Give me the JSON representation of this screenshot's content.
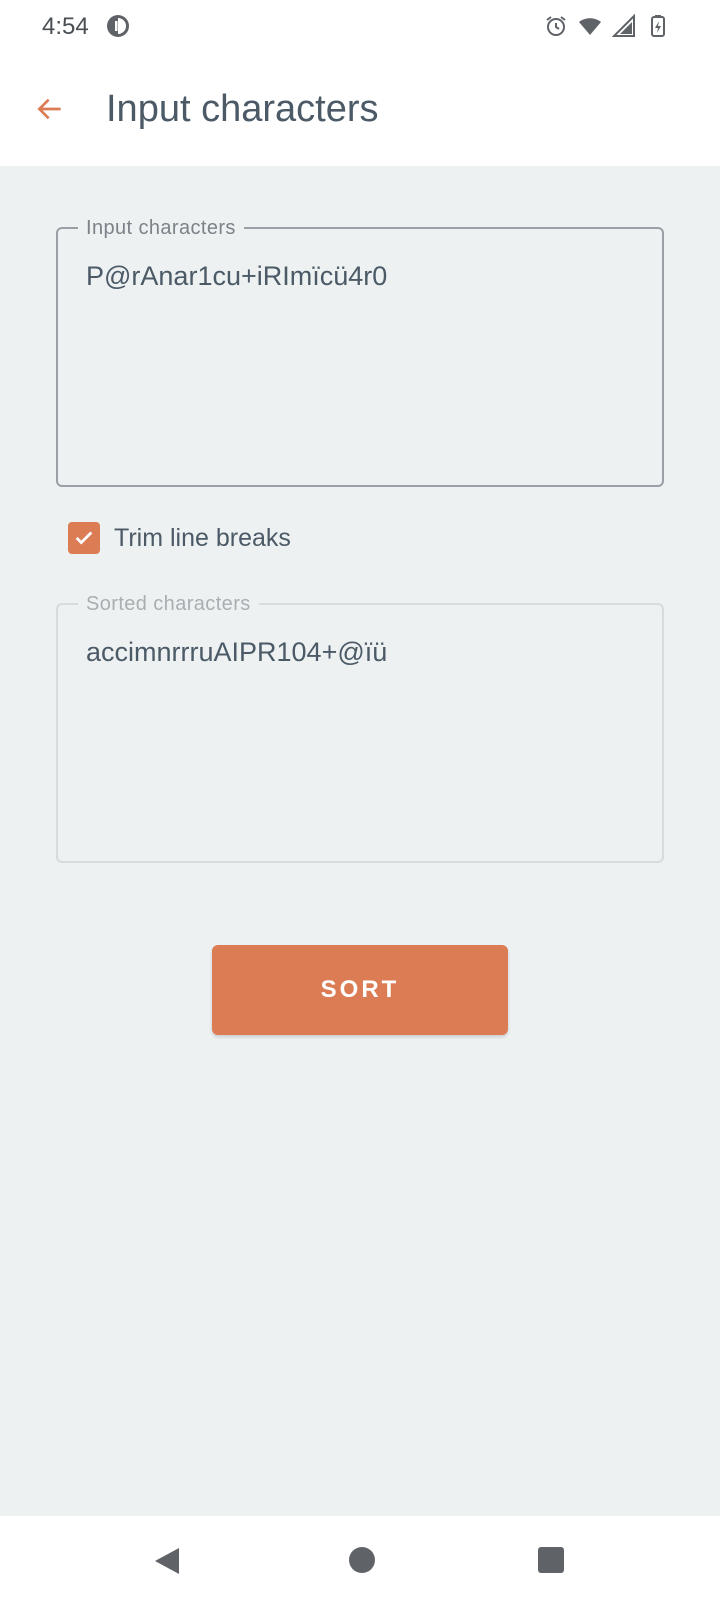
{
  "status_bar": {
    "time": "4:54",
    "icons": [
      "app-notification-icon",
      "alarm-icon",
      "wifi-icon",
      "signal-icon",
      "battery-charging-icon"
    ]
  },
  "app_bar": {
    "title": "Input characters",
    "back_icon": "arrow-back-icon"
  },
  "input_field": {
    "label": "Input characters",
    "value": "P@rAnar1cu+iRImïcü4r0"
  },
  "trim_checkbox": {
    "label": "Trim line breaks",
    "checked": true
  },
  "output_field": {
    "label": "Sorted characters",
    "value": "accimnrrruAIPR104+@ïü"
  },
  "sort_button": {
    "label": "SORT"
  },
  "colors": {
    "accent": "#dc7c55",
    "background": "#edf1f2",
    "text": "#4b5a66"
  },
  "nav_bar": {
    "icons": [
      "nav-back-icon",
      "nav-home-icon",
      "nav-recents-icon"
    ]
  }
}
